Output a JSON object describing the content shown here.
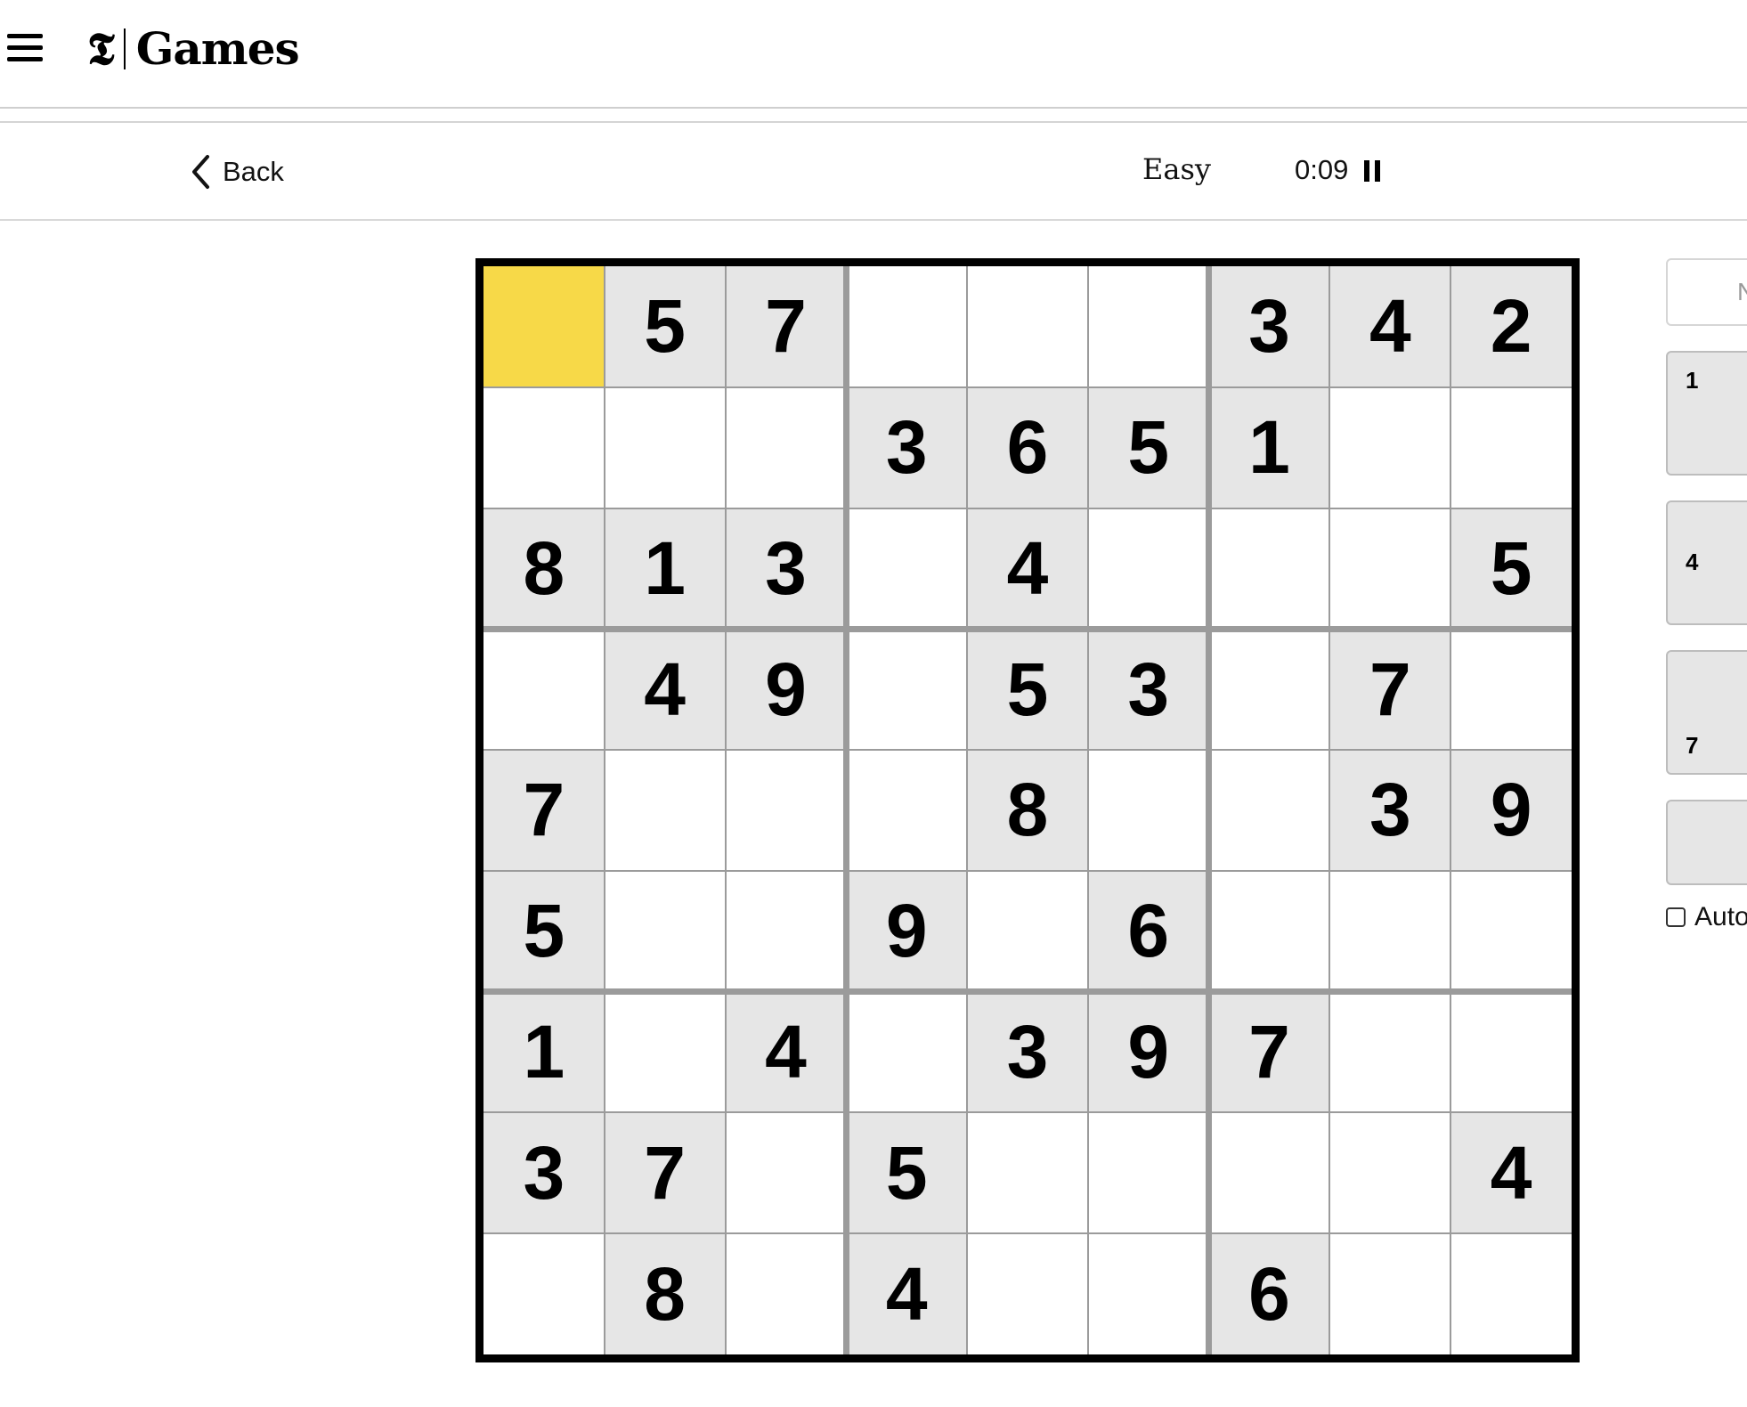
{
  "header": {
    "logo_t": "𝕿",
    "logo_text": "Games"
  },
  "subheader": {
    "back_label": "Back",
    "difficulty": "Easy",
    "timer": "0:09"
  },
  "board": {
    "selected": [
      0,
      0
    ],
    "cells": [
      [
        "",
        "5",
        "7",
        "",
        "",
        "",
        "3",
        "4",
        "2"
      ],
      [
        "",
        "",
        "",
        "3",
        "6",
        "5",
        "1",
        "",
        ""
      ],
      [
        "8",
        "1",
        "3",
        "",
        "4",
        "",
        "",
        "",
        "5"
      ],
      [
        "",
        "4",
        "9",
        "",
        "5",
        "3",
        "",
        "7",
        ""
      ],
      [
        "7",
        "",
        "",
        "",
        "8",
        "",
        "",
        "3",
        "9"
      ],
      [
        "5",
        "",
        "",
        "9",
        "",
        "6",
        "",
        "",
        ""
      ],
      [
        "1",
        "",
        "4",
        "",
        "3",
        "9",
        "7",
        "",
        ""
      ],
      [
        "3",
        "7",
        "",
        "5",
        "",
        "",
        "",
        "",
        "4"
      ],
      [
        "",
        "8",
        "",
        "4",
        "",
        "",
        "6",
        "",
        ""
      ]
    ]
  },
  "side_panel": {
    "mode_toggle_label": "N",
    "numpad_visible": [
      "1",
      "4",
      "7"
    ],
    "auto_label": "Auto"
  },
  "colors": {
    "selected_cell": "#f7d948",
    "given_cell": "#e6e6e6",
    "grid_line": "#9b9b9b",
    "board_border": "#000000"
  }
}
